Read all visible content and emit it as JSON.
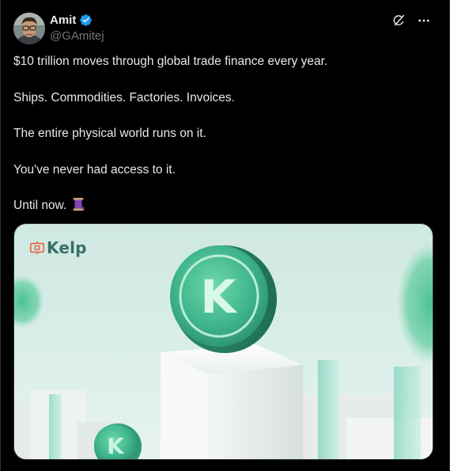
{
  "author": {
    "display_name": "Amit",
    "handle": "@GAmitej",
    "verified": true,
    "verified_color": "#1d9bf0"
  },
  "top_actions": {
    "icons": [
      "grok-icon",
      "more-options-icon"
    ]
  },
  "tweet": {
    "paragraphs": [
      "$10 trillion moves through global trade finance every year.",
      "Ships. Commodities. Factories. Invoices.",
      "The entire physical world runs on it.",
      "You've never had access to it.",
      "Until now."
    ],
    "trailing_emoji": "thread-spool-emoji"
  },
  "media": {
    "logo_text": "Kelp",
    "coin_letter": "K",
    "accent_color": "#3fb58c",
    "background_color": "#cfe7e1"
  }
}
